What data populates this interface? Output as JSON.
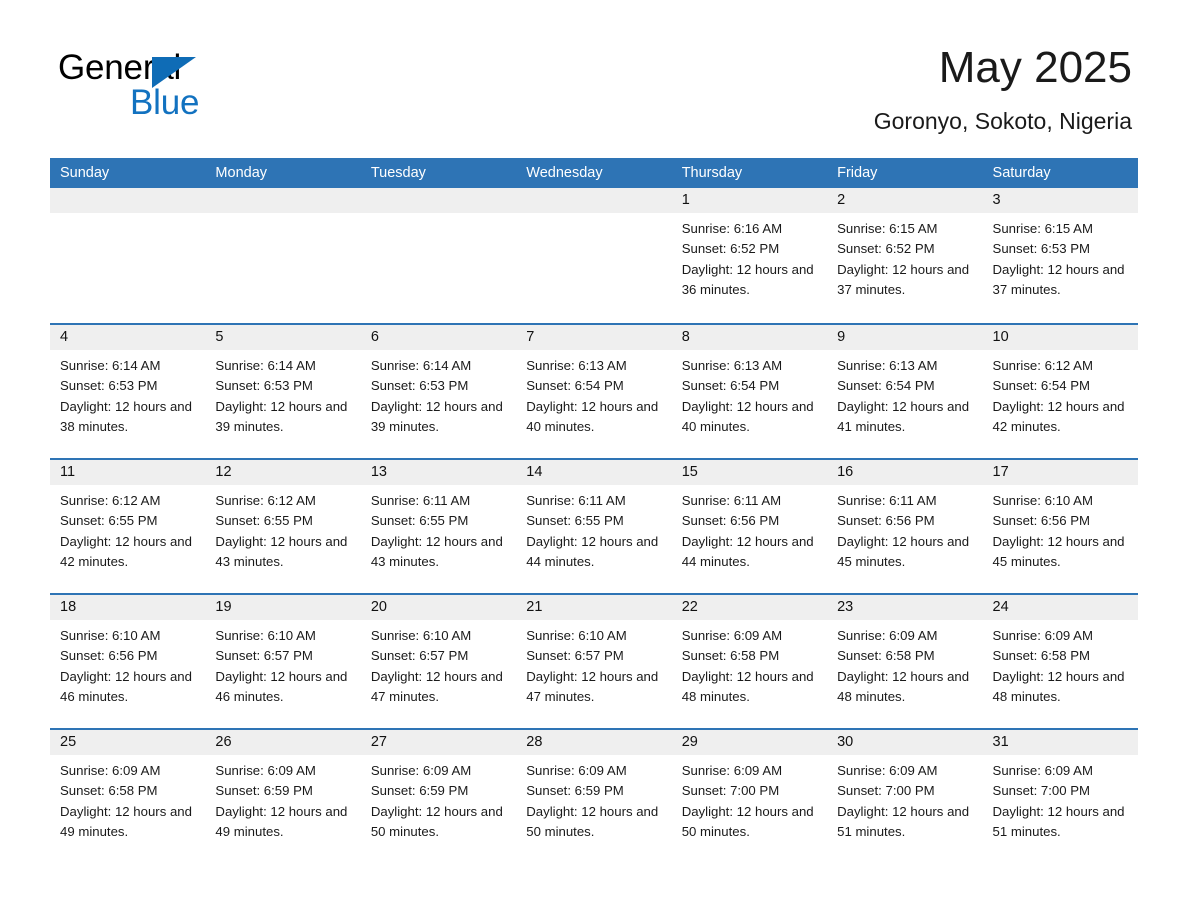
{
  "brand": {
    "name_part1": "General",
    "name_part2": "Blue",
    "triangle_color": "#0f6cb6",
    "blue_text_color": "#1272c0"
  },
  "header": {
    "title": "May 2025",
    "location": "Goronyo, Sokoto, Nigeria"
  },
  "theme": {
    "header_blue": "#2e74b5",
    "daynum_gray": "#efefef",
    "text_color": "#1a1a1a",
    "page_background": "#ffffff"
  },
  "weekday_headers": [
    "Sunday",
    "Monday",
    "Tuesday",
    "Wednesday",
    "Thursday",
    "Friday",
    "Saturday"
  ],
  "labels": {
    "sunrise_prefix": "Sunrise:",
    "sunset_prefix": "Sunset:",
    "daylight_prefix": "Daylight:"
  },
  "weeks": [
    [
      {
        "day": "",
        "sunrise": "",
        "sunset": "",
        "daylight": "",
        "empty": true
      },
      {
        "day": "",
        "sunrise": "",
        "sunset": "",
        "daylight": "",
        "empty": true
      },
      {
        "day": "",
        "sunrise": "",
        "sunset": "",
        "daylight": "",
        "empty": true
      },
      {
        "day": "",
        "sunrise": "",
        "sunset": "",
        "daylight": "",
        "empty": true
      },
      {
        "day": "1",
        "sunrise": "Sunrise: 6:16 AM",
        "sunset": "Sunset: 6:52 PM",
        "daylight": "Daylight: 12 hours and 36 minutes.",
        "empty": false
      },
      {
        "day": "2",
        "sunrise": "Sunrise: 6:15 AM",
        "sunset": "Sunset: 6:52 PM",
        "daylight": "Daylight: 12 hours and 37 minutes.",
        "empty": false
      },
      {
        "day": "3",
        "sunrise": "Sunrise: 6:15 AM",
        "sunset": "Sunset: 6:53 PM",
        "daylight": "Daylight: 12 hours and 37 minutes.",
        "empty": false
      }
    ],
    [
      {
        "day": "4",
        "sunrise": "Sunrise: 6:14 AM",
        "sunset": "Sunset: 6:53 PM",
        "daylight": "Daylight: 12 hours and 38 minutes.",
        "empty": false
      },
      {
        "day": "5",
        "sunrise": "Sunrise: 6:14 AM",
        "sunset": "Sunset: 6:53 PM",
        "daylight": "Daylight: 12 hours and 39 minutes.",
        "empty": false
      },
      {
        "day": "6",
        "sunrise": "Sunrise: 6:14 AM",
        "sunset": "Sunset: 6:53 PM",
        "daylight": "Daylight: 12 hours and 39 minutes.",
        "empty": false
      },
      {
        "day": "7",
        "sunrise": "Sunrise: 6:13 AM",
        "sunset": "Sunset: 6:54 PM",
        "daylight": "Daylight: 12 hours and 40 minutes.",
        "empty": false
      },
      {
        "day": "8",
        "sunrise": "Sunrise: 6:13 AM",
        "sunset": "Sunset: 6:54 PM",
        "daylight": "Daylight: 12 hours and 40 minutes.",
        "empty": false
      },
      {
        "day": "9",
        "sunrise": "Sunrise: 6:13 AM",
        "sunset": "Sunset: 6:54 PM",
        "daylight": "Daylight: 12 hours and 41 minutes.",
        "empty": false
      },
      {
        "day": "10",
        "sunrise": "Sunrise: 6:12 AM",
        "sunset": "Sunset: 6:54 PM",
        "daylight": "Daylight: 12 hours and 42 minutes.",
        "empty": false
      }
    ],
    [
      {
        "day": "11",
        "sunrise": "Sunrise: 6:12 AM",
        "sunset": "Sunset: 6:55 PM",
        "daylight": "Daylight: 12 hours and 42 minutes.",
        "empty": false
      },
      {
        "day": "12",
        "sunrise": "Sunrise: 6:12 AM",
        "sunset": "Sunset: 6:55 PM",
        "daylight": "Daylight: 12 hours and 43 minutes.",
        "empty": false
      },
      {
        "day": "13",
        "sunrise": "Sunrise: 6:11 AM",
        "sunset": "Sunset: 6:55 PM",
        "daylight": "Daylight: 12 hours and 43 minutes.",
        "empty": false
      },
      {
        "day": "14",
        "sunrise": "Sunrise: 6:11 AM",
        "sunset": "Sunset: 6:55 PM",
        "daylight": "Daylight: 12 hours and 44 minutes.",
        "empty": false
      },
      {
        "day": "15",
        "sunrise": "Sunrise: 6:11 AM",
        "sunset": "Sunset: 6:56 PM",
        "daylight": "Daylight: 12 hours and 44 minutes.",
        "empty": false
      },
      {
        "day": "16",
        "sunrise": "Sunrise: 6:11 AM",
        "sunset": "Sunset: 6:56 PM",
        "daylight": "Daylight: 12 hours and 45 minutes.",
        "empty": false
      },
      {
        "day": "17",
        "sunrise": "Sunrise: 6:10 AM",
        "sunset": "Sunset: 6:56 PM",
        "daylight": "Daylight: 12 hours and 45 minutes.",
        "empty": false
      }
    ],
    [
      {
        "day": "18",
        "sunrise": "Sunrise: 6:10 AM",
        "sunset": "Sunset: 6:56 PM",
        "daylight": "Daylight: 12 hours and 46 minutes.",
        "empty": false
      },
      {
        "day": "19",
        "sunrise": "Sunrise: 6:10 AM",
        "sunset": "Sunset: 6:57 PM",
        "daylight": "Daylight: 12 hours and 46 minutes.",
        "empty": false
      },
      {
        "day": "20",
        "sunrise": "Sunrise: 6:10 AM",
        "sunset": "Sunset: 6:57 PM",
        "daylight": "Daylight: 12 hours and 47 minutes.",
        "empty": false
      },
      {
        "day": "21",
        "sunrise": "Sunrise: 6:10 AM",
        "sunset": "Sunset: 6:57 PM",
        "daylight": "Daylight: 12 hours and 47 minutes.",
        "empty": false
      },
      {
        "day": "22",
        "sunrise": "Sunrise: 6:09 AM",
        "sunset": "Sunset: 6:58 PM",
        "daylight": "Daylight: 12 hours and 48 minutes.",
        "empty": false
      },
      {
        "day": "23",
        "sunrise": "Sunrise: 6:09 AM",
        "sunset": "Sunset: 6:58 PM",
        "daylight": "Daylight: 12 hours and 48 minutes.",
        "empty": false
      },
      {
        "day": "24",
        "sunrise": "Sunrise: 6:09 AM",
        "sunset": "Sunset: 6:58 PM",
        "daylight": "Daylight: 12 hours and 48 minutes.",
        "empty": false
      }
    ],
    [
      {
        "day": "25",
        "sunrise": "Sunrise: 6:09 AM",
        "sunset": "Sunset: 6:58 PM",
        "daylight": "Daylight: 12 hours and 49 minutes.",
        "empty": false
      },
      {
        "day": "26",
        "sunrise": "Sunrise: 6:09 AM",
        "sunset": "Sunset: 6:59 PM",
        "daylight": "Daylight: 12 hours and 49 minutes.",
        "empty": false
      },
      {
        "day": "27",
        "sunrise": "Sunrise: 6:09 AM",
        "sunset": "Sunset: 6:59 PM",
        "daylight": "Daylight: 12 hours and 50 minutes.",
        "empty": false
      },
      {
        "day": "28",
        "sunrise": "Sunrise: 6:09 AM",
        "sunset": "Sunset: 6:59 PM",
        "daylight": "Daylight: 12 hours and 50 minutes.",
        "empty": false
      },
      {
        "day": "29",
        "sunrise": "Sunrise: 6:09 AM",
        "sunset": "Sunset: 7:00 PM",
        "daylight": "Daylight: 12 hours and 50 minutes.",
        "empty": false
      },
      {
        "day": "30",
        "sunrise": "Sunrise: 6:09 AM",
        "sunset": "Sunset: 7:00 PM",
        "daylight": "Daylight: 12 hours and 51 minutes.",
        "empty": false
      },
      {
        "day": "31",
        "sunrise": "Sunrise: 6:09 AM",
        "sunset": "Sunset: 7:00 PM",
        "daylight": "Daylight: 12 hours and 51 minutes.",
        "empty": false
      }
    ]
  ]
}
